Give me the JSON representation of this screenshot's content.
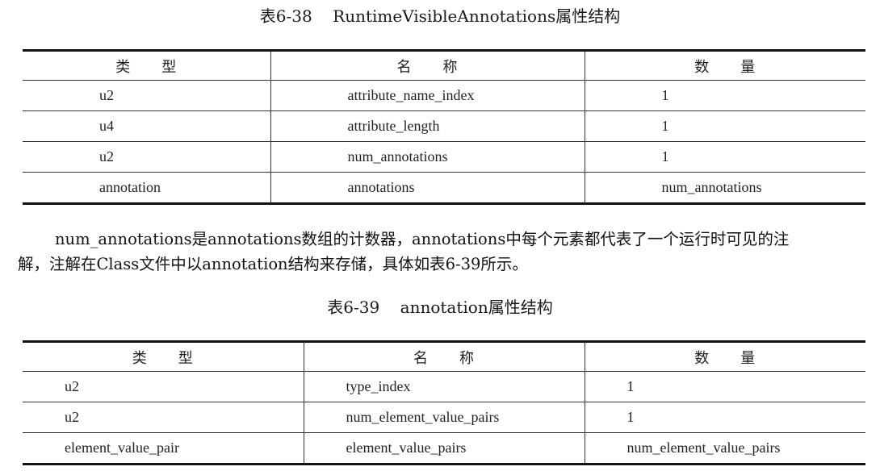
{
  "table1": {
    "caption": "表6-38    RuntimeVisibleAnnotations属性结构",
    "headers": [
      "类　　型",
      "名　　称",
      "数　　量"
    ],
    "rows": [
      [
        "u2",
        "attribute_name_index",
        "1"
      ],
      [
        "u4",
        "attribute_length",
        "1"
      ],
      [
        "u2",
        "num_annotations",
        "1"
      ],
      [
        "annotation",
        "annotations",
        "num_annotations"
      ]
    ]
  },
  "paragraph": {
    "line1": "num_annotations是annotations数组的计数器，annotations中每个元素都代表了一个运行时可见的注",
    "line2": "解，注解在Class文件中以annotation结构来存储，具体如表6-39所示。"
  },
  "table2": {
    "caption": "表6-39    annotation属性结构",
    "headers": [
      "类　　型",
      "名　　称",
      "数　　量"
    ],
    "rows": [
      [
        "u2",
        "type_index",
        "1"
      ],
      [
        "u2",
        "num_element_value_pairs",
        "1"
      ],
      [
        "element_value_pair",
        "element_value_pairs",
        "num_element_value_pairs"
      ]
    ]
  }
}
